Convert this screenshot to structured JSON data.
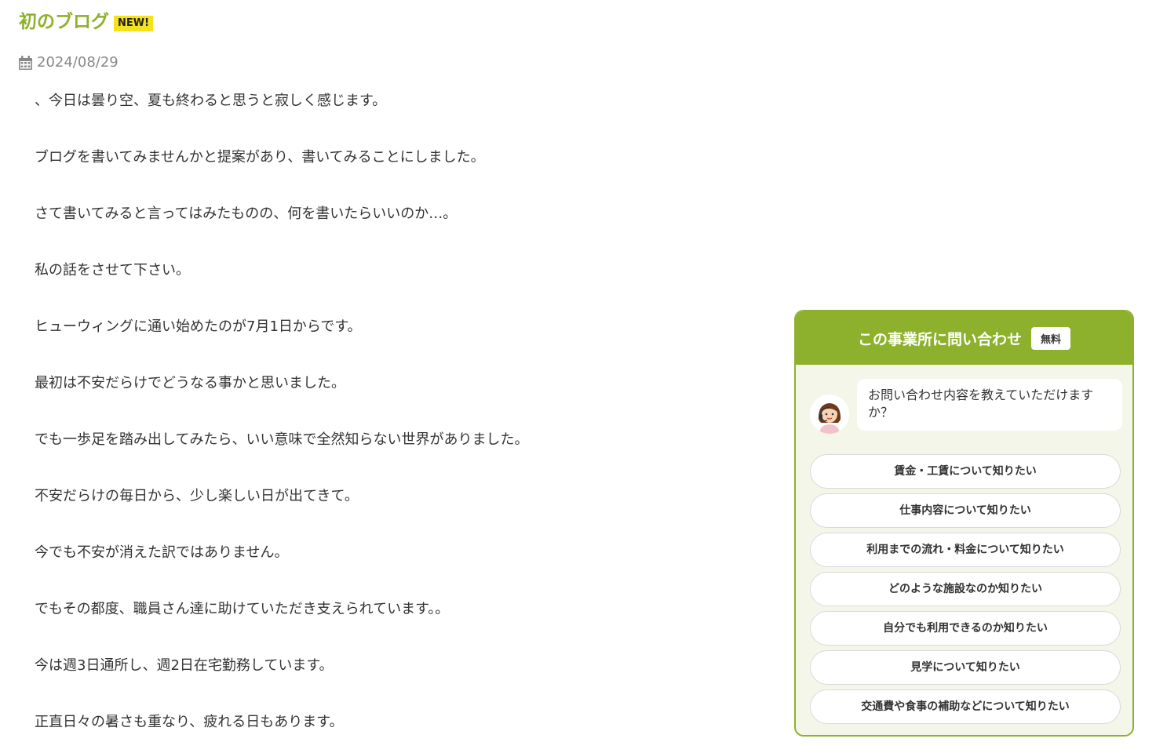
{
  "post": {
    "title": "初のブログ",
    "new_badge": "NEW!",
    "date": "2024/08/29",
    "paragraphs": [
      "、今日は曇り空、夏も終わると思うと寂しく感じます。",
      "ブログを書いてみませんかと提案があり、書いてみることにしました。",
      "さて書いてみると言ってはみたものの、何を書いたらいいのか…。",
      "私の話をさせて下さい。",
      "ヒューウィングに通い始めたのが7月1日からです。",
      "最初は不安だらけでどうなる事かと思いました。",
      "でも一歩足を踏み出してみたら、いい意味で全然知らない世界がありました。",
      "不安だらけの毎日から、少し楽しい日が出てきて。",
      "今でも不安が消えた訳ではありません。",
      "でもその都度、職員さん達に助けていただき支えられています。。",
      "今は週3日通所し、週2日在宅勤務しています。",
      "正直日々の暑さも重なり、疲れる日もあります。"
    ]
  },
  "widget": {
    "title": "この事業所に問い合わせ",
    "free_badge": "無料",
    "question": "お問い合わせ内容を教えていただけますか？",
    "options": [
      "賃金・工賃について知りたい",
      "仕事内容について知りたい",
      "利用までの流れ・料金について知りたい",
      "どのような施設なのか知りたい",
      "自分でも利用できるのか知りたい",
      "見学について知りたい",
      "交通費や食事の補助などについて知りたい"
    ]
  },
  "colors": {
    "accent": "#8db12c",
    "badge": "#f5e11c",
    "widget_bg": "#f4f6ea"
  },
  "icons": {
    "date": "calendar-icon",
    "avatar": "operator-avatar-icon"
  }
}
